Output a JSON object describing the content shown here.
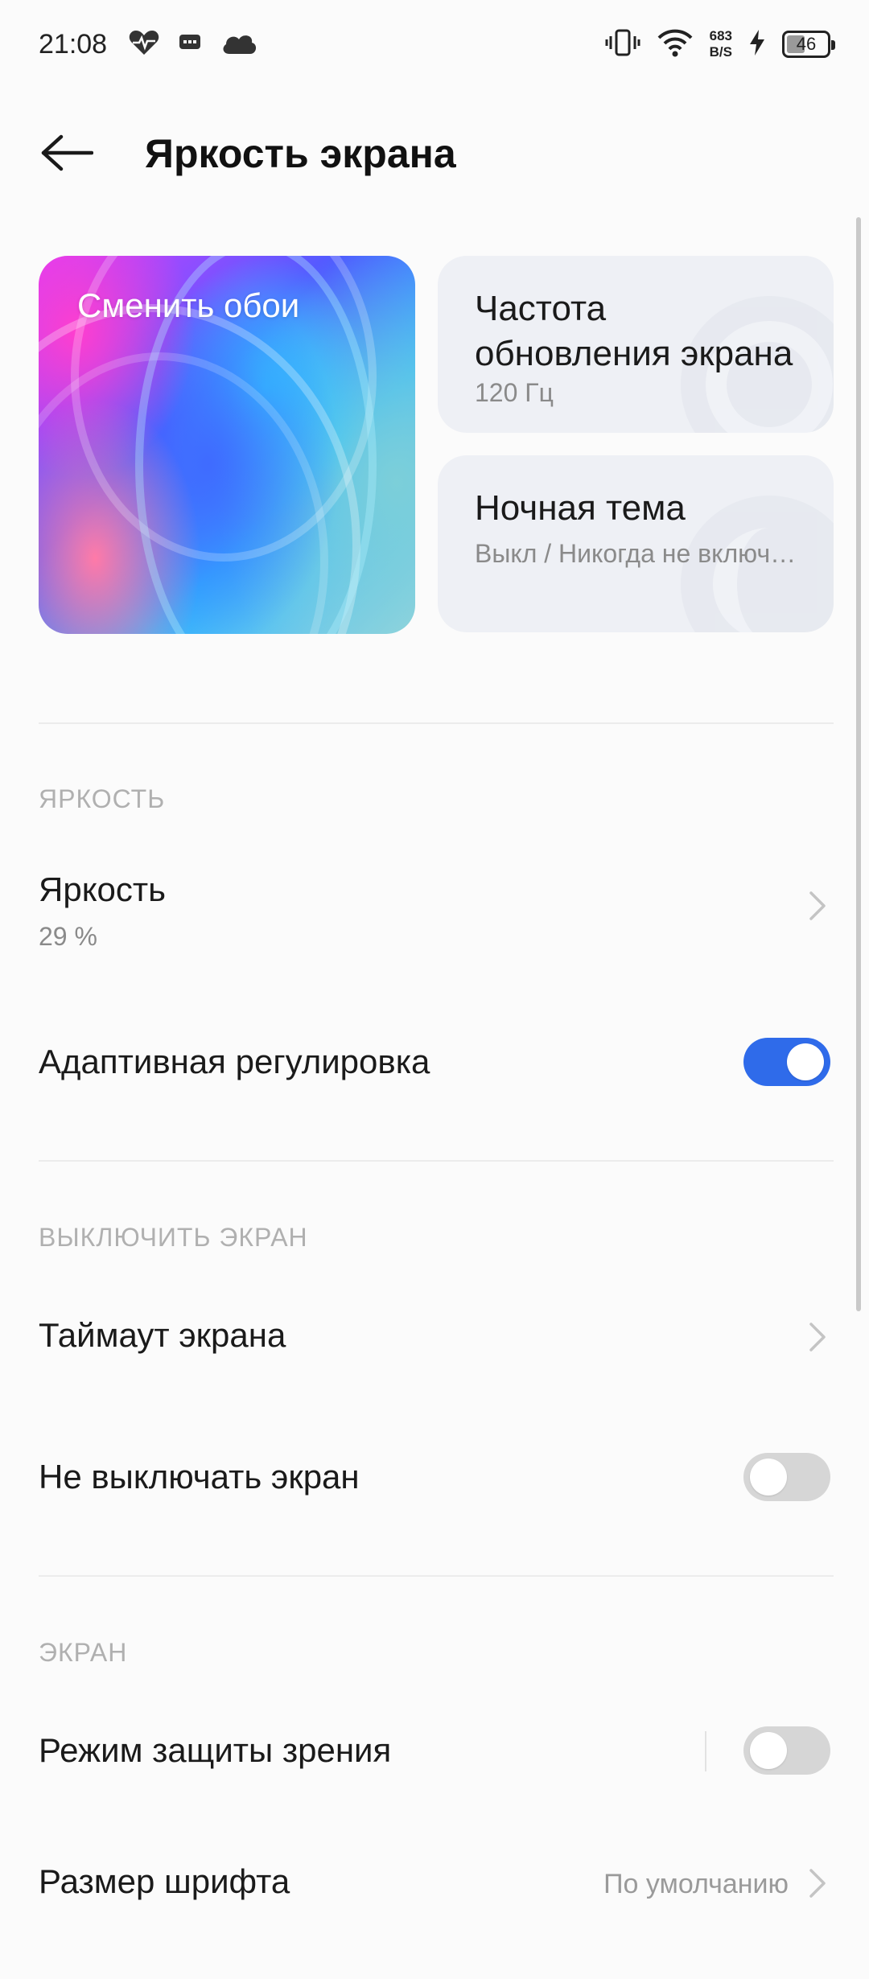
{
  "status_bar": {
    "time": "21:08",
    "net_speed_value": "683",
    "net_speed_unit": "B/S",
    "battery_level": "46",
    "battery_fraction": 0.46
  },
  "header": {
    "title": "Яркость экрана"
  },
  "cards": {
    "wallpaper_label": "Сменить обои",
    "refresh_rate": {
      "title_line1": "Частота",
      "title_line2": "обновления экрана",
      "subtitle": "120 Гц"
    },
    "night_theme": {
      "title": "Ночная тема",
      "subtitle": "Выкл / Никогда не включать"
    }
  },
  "sections": {
    "brightness": {
      "header": "ЯРКОСТЬ",
      "brightness_item": {
        "title": "Яркость",
        "value": "29 %"
      },
      "adaptive_item": {
        "title": "Адаптивная регулировка",
        "enabled": true
      }
    },
    "screen_off": {
      "header": "ВЫКЛЮЧИТЬ ЭКРАН",
      "timeout_item": {
        "title": "Таймаут экрана"
      },
      "keep_on_item": {
        "title": "Не выключать экран",
        "enabled": false
      }
    },
    "screen": {
      "header": "ЭКРАН",
      "eye_protection_item": {
        "title": "Режим защиты зрения",
        "enabled": false
      },
      "font_size_item": {
        "title": "Размер шрифта",
        "value": "По умолчанию"
      }
    }
  },
  "colors": {
    "accent": "#2f6bea",
    "background": "#fbfbfb",
    "card_background": "#eef0f5"
  }
}
